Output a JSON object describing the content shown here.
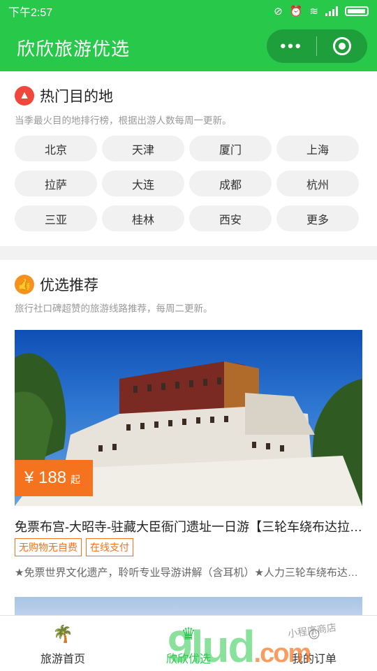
{
  "status_bar": {
    "time": "下午2:57"
  },
  "nav": {
    "title": "欣欣旅游优选",
    "more_glyph": "•••"
  },
  "hot": {
    "title": "热门目的地",
    "subtitle": "当季最火目的地排行榜，根据出游人数每周一更新。",
    "icon": "flame-icon",
    "icon_color": "#f0463c",
    "cities": [
      "北京",
      "天津",
      "厦门",
      "上海",
      "拉萨",
      "大连",
      "成都",
      "杭州",
      "三亚",
      "桂林",
      "西安",
      "更多"
    ]
  },
  "recommend": {
    "title": "优选推荐",
    "subtitle": "旅行社口碑超赞的旅游线路推荐，每周二更新。",
    "icon": "thumbs-up-icon",
    "icon_color": "#f5921f",
    "items": [
      {
        "price": "¥ 188",
        "price_unit": "起",
        "title": "免票布宫-大昭寺-驻藏大臣衙门遗址一日游【三轮车绕布达拉宫】",
        "tags": [
          "无购物无自费",
          "在线支付"
        ],
        "desc": "★免票世界文化遗产，聆听专业导游讲解（含耳机）★人力三轮车绕布达拉宫"
      }
    ]
  },
  "tabbar": {
    "tabs": [
      {
        "label": "旅游首页",
        "icon": "palm-tree-icon"
      },
      {
        "label": "欣欣优选",
        "icon": "crown-icon"
      },
      {
        "label": "我的订单",
        "icon": "user-icon"
      }
    ],
    "active_index": 1
  },
  "watermark": {
    "text": "9lud",
    "suffix": ".com",
    "sub": "小程序商店"
  },
  "colors": {
    "primary": "#28c84a",
    "accent": "#f5731f"
  }
}
